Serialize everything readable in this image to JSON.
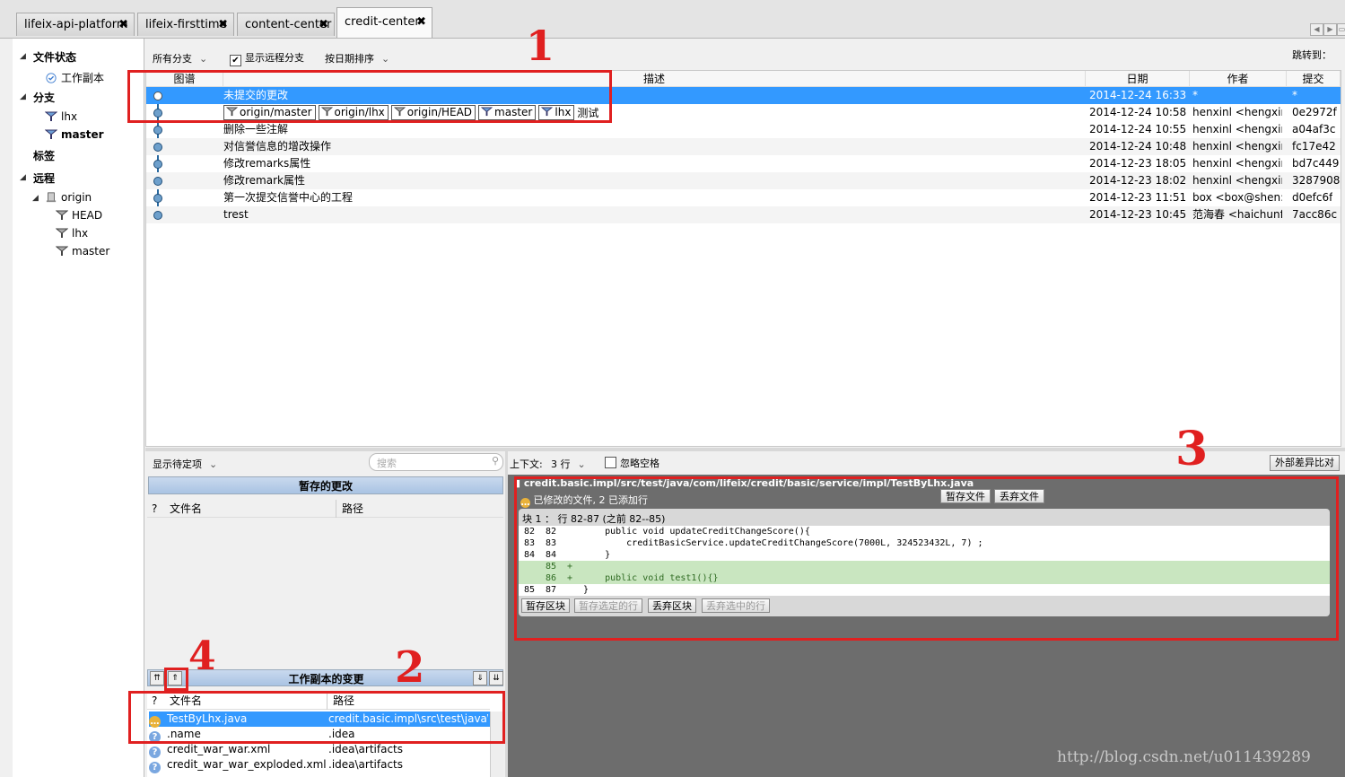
{
  "tabs": [
    {
      "label": "lifeix-api-platform"
    },
    {
      "label": "lifeix-firsttime"
    },
    {
      "label": "content-center"
    },
    {
      "label": "credit-center"
    }
  ],
  "sidebar": {
    "file_status": "文件状态",
    "working_copy": "工作副本",
    "branches": "分支",
    "branch_items": [
      "lhx",
      "master"
    ],
    "tags": "标签",
    "remotes": "远程",
    "origin": "origin",
    "remote_items": [
      "HEAD",
      "lhx",
      "master"
    ]
  },
  "toolbar": {
    "all_branches": "所有分支",
    "show_remote": "显示远程分支",
    "sort_by_date": "按日期排序",
    "jump_to": "跳转到："
  },
  "log": {
    "columns": {
      "graph": "图谱",
      "desc": "描述",
      "date": "日期",
      "author": "作者",
      "commit": "提交"
    },
    "rows": [
      {
        "desc": "未提交的更改",
        "date": "2014-12-24 16:33",
        "author": "*",
        "commit": "*"
      },
      {
        "desc": "测试",
        "date": "2014-12-24 10:58",
        "author": "henxinl <hengxin",
        "commit": "0e2972f"
      },
      {
        "desc": "删除一些注解",
        "date": "2014-12-24 10:55",
        "author": "henxinl <hengxin",
        "commit": "a04af3c"
      },
      {
        "desc": "对信誉信息的增改操作",
        "date": "2014-12-24 10:48",
        "author": "henxinl <hengxin",
        "commit": "fc17e42"
      },
      {
        "desc": "修改remarks属性",
        "date": "2014-12-23 18:05",
        "author": "henxinl <hengxin",
        "commit": "bd7c449"
      },
      {
        "desc": "修改remark属性",
        "date": "2014-12-23 18:02",
        "author": "henxinl <hengxin",
        "commit": "3287908"
      },
      {
        "desc": "第一次提交信誉中心的工程",
        "date": "2014-12-23 11:51",
        "author": "box <box@shen:",
        "commit": "d0efc6f"
      },
      {
        "desc": "trest",
        "date": "2014-12-23 10:45",
        "author": "范海春 <haichunf",
        "commit": "7acc86c"
      }
    ],
    "ref_tags": [
      "origin/master",
      "origin/lhx",
      "origin/HEAD",
      "master",
      "lhx"
    ]
  },
  "pending": {
    "show_pending": "显示待定项",
    "search_placeholder": "搜索",
    "staged_title": "暂存的更改",
    "col_q": "?",
    "col_filename": "文件名",
    "col_path": "路径",
    "working_title": "工作副本的变更",
    "files": [
      {
        "name": "TestByLhx.java",
        "path": "credit.basic.impl\\src\\test\\java\\"
      },
      {
        "name": ".name",
        "path": ".idea"
      },
      {
        "name": "credit_war_war.xml",
        "path": ".idea\\artifacts"
      },
      {
        "name": "credit_war_war_exploded.xml",
        "path": ".idea\\artifacts"
      }
    ]
  },
  "diff": {
    "context_label": "上下文:",
    "context_value": "3 行",
    "ignore_whitespace": "忽略空格",
    "external_diff": "外部差异比对",
    "file_path": "credit.basic.impl/src/test/java/com/lifeix/credit/basic/service/impl/TestByLhx.java",
    "file_status": "已修改的文件, 2 已添加行",
    "stage_file": "暂存文件",
    "discard_file": "丢弃文件",
    "hunk_header": "块 1 ： 行 82-87 (之前 82--85)",
    "lines": [
      {
        "old": "82",
        "new": "82",
        "sign": "",
        "text": "    public void updateCreditChangeScore(){",
        "added": false
      },
      {
        "old": "83",
        "new": "83",
        "sign": "",
        "text": "        creditBasicService.updateCreditChangeScore(7000L, 324523432L, 7) ;",
        "added": false
      },
      {
        "old": "84",
        "new": "84",
        "sign": "",
        "text": "    }",
        "added": false
      },
      {
        "old": "",
        "new": "85",
        "sign": "+",
        "text": "",
        "added": true
      },
      {
        "old": "",
        "new": "86",
        "sign": "+",
        "text": "    public void test1(){}",
        "added": true
      },
      {
        "old": "85",
        "new": "87",
        "sign": "",
        "text": "}",
        "added": false
      }
    ],
    "stage_hunk": "暂存区块",
    "stage_selected": "暂存选定的行",
    "discard_hunk": "丢弃区块",
    "discard_selected": "丢弃选中的行"
  },
  "annotations": [
    "1",
    "2",
    "3",
    "4"
  ],
  "watermark": "http://blog.csdn.net/u011439289",
  "colors": {
    "selection": "#3399ff",
    "annotation": "#e02020",
    "added_line": "#c9e6c0",
    "diff_bg": "#6d6d6d"
  }
}
